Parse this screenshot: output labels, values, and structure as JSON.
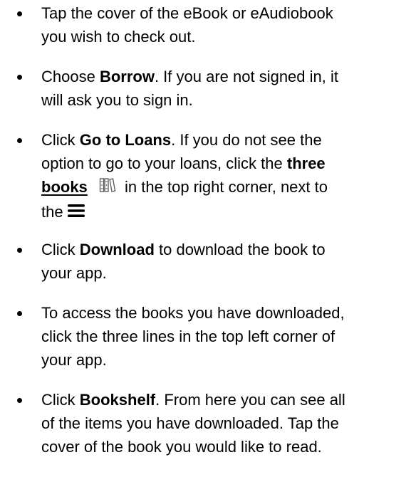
{
  "steps": [
    {
      "line1": "Tap the cover of the eBook or eAudiobook",
      "line2": "you wish to check out."
    },
    {
      "pre": "Choose ",
      "bold": "Borrow",
      "post": ". If you are not signed in, it",
      "line2": "will ask you to sign in."
    },
    {
      "pre": "Click ",
      "bold": "Go to Loans",
      "post": ". If you do not see the",
      "line2a": "option to go to your loans, click the ",
      "line2b": "three",
      "line3a": "books",
      "line3b": " in the top right corner, next to",
      "line4": "the ",
      "icon_books": "three-books-icon",
      "icon_menu": "hamburger-menu-icon"
    },
    {
      "pre": "Click ",
      "bold": "Download",
      "post": " to download the book to",
      "line2": "your app."
    },
    {
      "line1": "To access the books you have downloaded,",
      "line2": "click the three lines in the top left corner of",
      "line3": "your app."
    },
    {
      "pre": "Click ",
      "bold": "Bookshelf",
      "post": ". From here you can see all",
      "line2": "of the items you have downloaded. Tap the",
      "line3": "cover of the book you would like to read."
    }
  ]
}
